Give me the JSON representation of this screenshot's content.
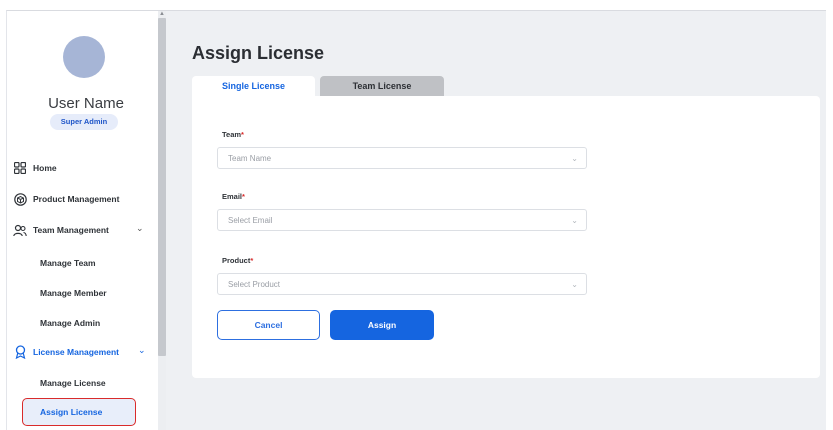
{
  "user": {
    "name": "User Name",
    "role": "Super Admin"
  },
  "sidebar": {
    "items": [
      {
        "label": "Home",
        "icon": "home-grid-icon"
      },
      {
        "label": "Product Management",
        "icon": "product-box-icon"
      },
      {
        "label": "Team Management",
        "icon": "team-users-icon"
      },
      {
        "label": "License Management",
        "icon": "license-award-icon"
      }
    ],
    "team_sub": [
      "Manage Team",
      "Manage Member",
      "Manage Admin"
    ],
    "license_sub": [
      "Manage License",
      "Assign License"
    ],
    "active_item": "Assign License"
  },
  "page": {
    "title": "Assign License"
  },
  "tabs": [
    {
      "label": "Single License",
      "active": true
    },
    {
      "label": "Team License",
      "active": false
    }
  ],
  "form": {
    "team": {
      "label": "Team",
      "required": "*",
      "placeholder": "Team Name"
    },
    "email": {
      "label": "Email",
      "required": "*",
      "placeholder": "Select Email"
    },
    "product": {
      "label": "Product",
      "required": "*",
      "placeholder": "Select Product"
    }
  },
  "buttons": {
    "cancel": "Cancel",
    "assign": "Assign"
  },
  "colors": {
    "accent": "#1565e0",
    "required": "#d92b2b",
    "highlight_border": "#d92b2b",
    "background": "#eef0f3"
  }
}
